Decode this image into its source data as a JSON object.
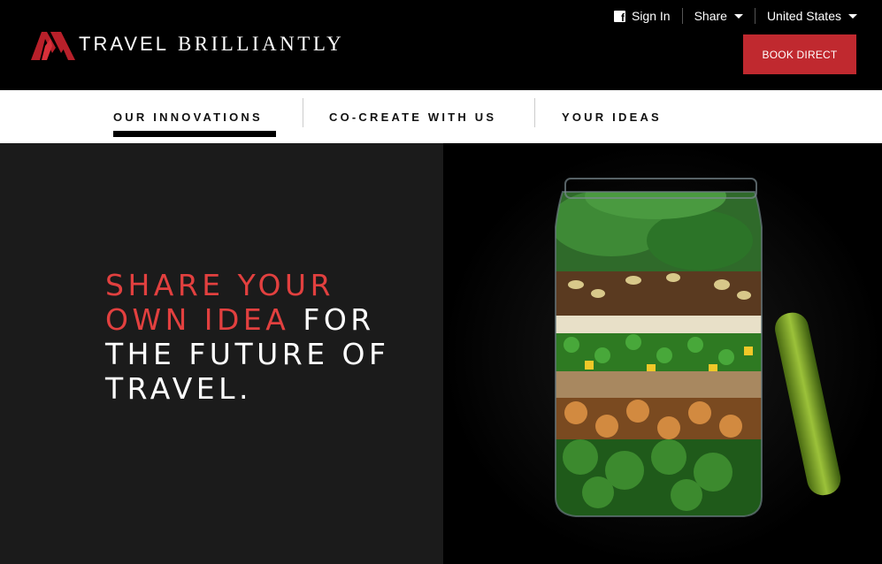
{
  "brand": {
    "wordmark_a": "TRAVEL",
    "wordmark_b": "BRILLIANTLY",
    "logo_icon": "marriott-m-logo",
    "accent_color": "#c0292f"
  },
  "utility_nav": {
    "sign_in": "Sign In",
    "share": "Share",
    "region": "United States"
  },
  "header": {
    "book_direct": "BOOK DIRECT"
  },
  "nav": {
    "tabs": [
      {
        "label": "OUR INNOVATIONS",
        "active": true
      },
      {
        "label": "CO-CREATE WITH US",
        "active": false
      },
      {
        "label": "YOUR IDEAS",
        "active": false
      }
    ]
  },
  "hero": {
    "headline_red_1": "SHARE YOUR",
    "headline_red_2": "OWN IDEA",
    "headline_white_2": " FOR",
    "headline_white_3": "THE FUTURE OF",
    "headline_white_4": "TRAVEL.",
    "image": "salad-jar-photo"
  }
}
